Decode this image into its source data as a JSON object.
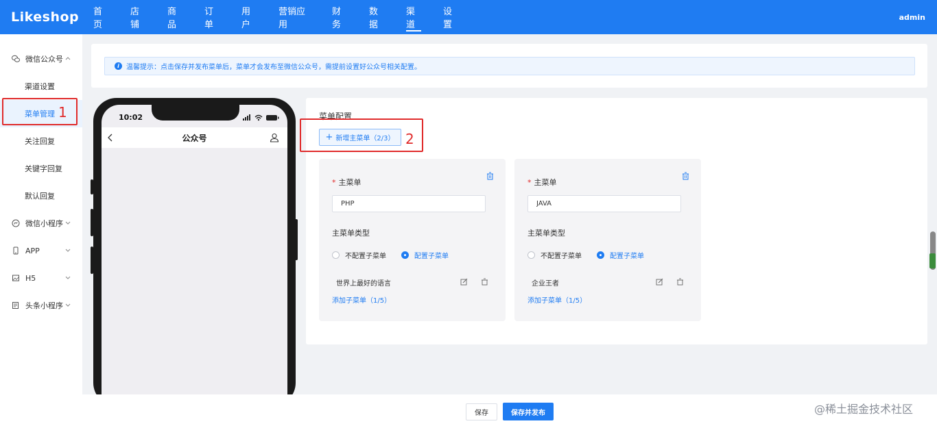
{
  "header": {
    "logo": "Likeshop",
    "nav": [
      {
        "label": "首页"
      },
      {
        "label": "店铺"
      },
      {
        "label": "商品"
      },
      {
        "label": "订单"
      },
      {
        "label": "用户"
      },
      {
        "label": "营销应用"
      },
      {
        "label": "财务"
      },
      {
        "label": "数据"
      },
      {
        "label": "渠道",
        "active": true
      },
      {
        "label": "设置"
      }
    ],
    "user": "admin"
  },
  "sidebar": {
    "groups": [
      {
        "label": "微信公众号",
        "icon": "wechat-icon",
        "expanded": true,
        "items": [
          "渠道设置",
          "菜单管理",
          "关注回复",
          "关键字回复",
          "默认回复"
        ],
        "active_item": "菜单管理"
      },
      {
        "label": "微信小程序",
        "icon": "mini-program-icon"
      },
      {
        "label": "APP",
        "icon": "phone-icon"
      },
      {
        "label": "H5",
        "icon": "image-icon"
      },
      {
        "label": "头条小程序",
        "icon": "toutiao-icon"
      }
    ]
  },
  "annotations": {
    "one": "1",
    "two": "2"
  },
  "notice": {
    "text": "温馨提示：点击保存并发布菜单后，菜单才会发布至微信公众号，需提前设置好公众号相关配置。"
  },
  "phone": {
    "time": "10:02",
    "title": "公众号"
  },
  "config": {
    "title": "菜单配置",
    "add_main_label": "新增主菜单（2/3）",
    "main_label": "主菜单",
    "type_label": "主菜单类型",
    "radio_no_sub": "不配置子菜单",
    "radio_with_sub": "配置子菜单",
    "add_sub_label": "添加子菜单（1/5）",
    "menus": [
      {
        "name": "PHP",
        "submenu": "世界上最好的语言"
      },
      {
        "name": "JAVA",
        "submenu": "企业王者"
      }
    ]
  },
  "footer": {
    "save": "保存",
    "publish": "保存并发布"
  },
  "watermark": "@稀土掘金技术社区",
  "colors": {
    "primary": "#1f7cf2",
    "annotation": "#e02a2a"
  }
}
